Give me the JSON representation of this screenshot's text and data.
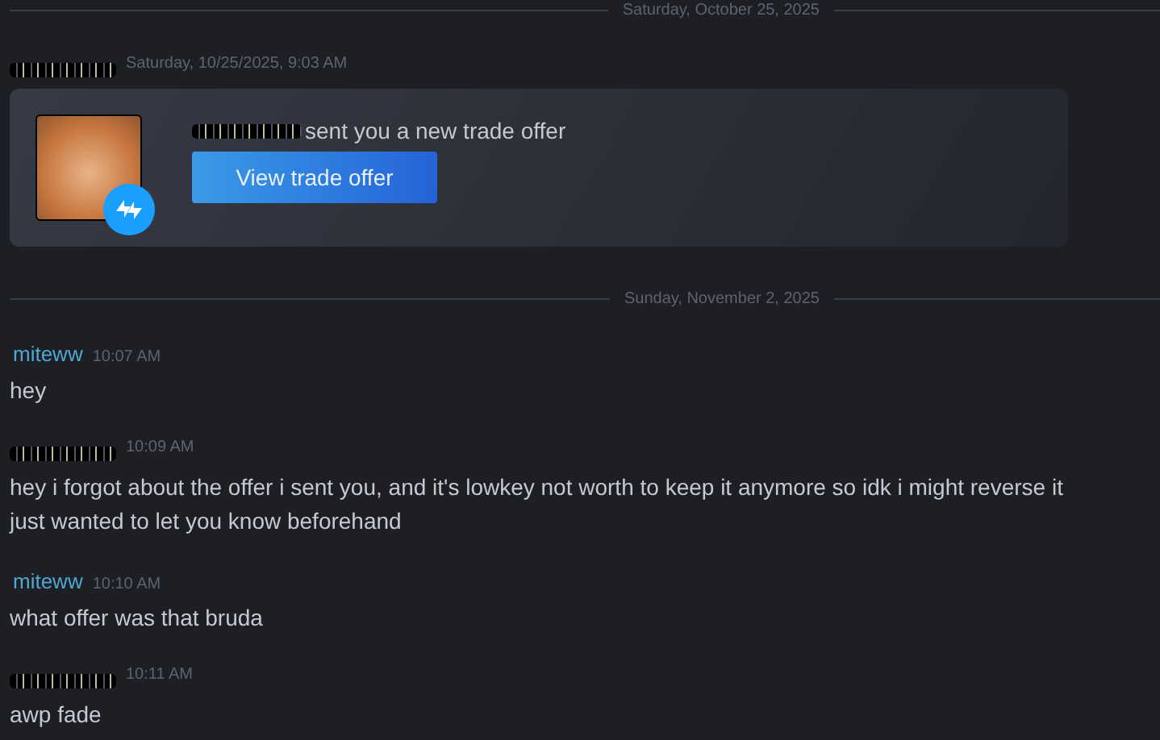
{
  "dividers": [
    {
      "label": "Saturday, October 25, 2025"
    },
    {
      "label": "Sunday, November 2, 2025"
    }
  ],
  "trade_post": {
    "author_hidden": true,
    "timestamp": "Saturday, 10/25/2025, 9:03 AM",
    "card": {
      "sender_hidden": true,
      "message": "sent you a new trade offer",
      "button": "View trade offer"
    }
  },
  "messages": [
    {
      "author": "miteww",
      "author_hidden": false,
      "time": "10:07 AM",
      "lines": [
        "hey"
      ]
    },
    {
      "author_hidden": true,
      "time": "10:09 AM",
      "lines": [
        "hey i forgot about the offer i sent you, and it's lowkey not worth to keep it anymore so idk i might reverse it",
        "just wanted to let you know beforehand"
      ]
    },
    {
      "author": "miteww",
      "author_hidden": false,
      "time": "10:10 AM",
      "lines": [
        "what offer was that bruda"
      ]
    },
    {
      "author_hidden": true,
      "time": "10:11 AM",
      "lines": [
        "awp fade"
      ]
    }
  ]
}
